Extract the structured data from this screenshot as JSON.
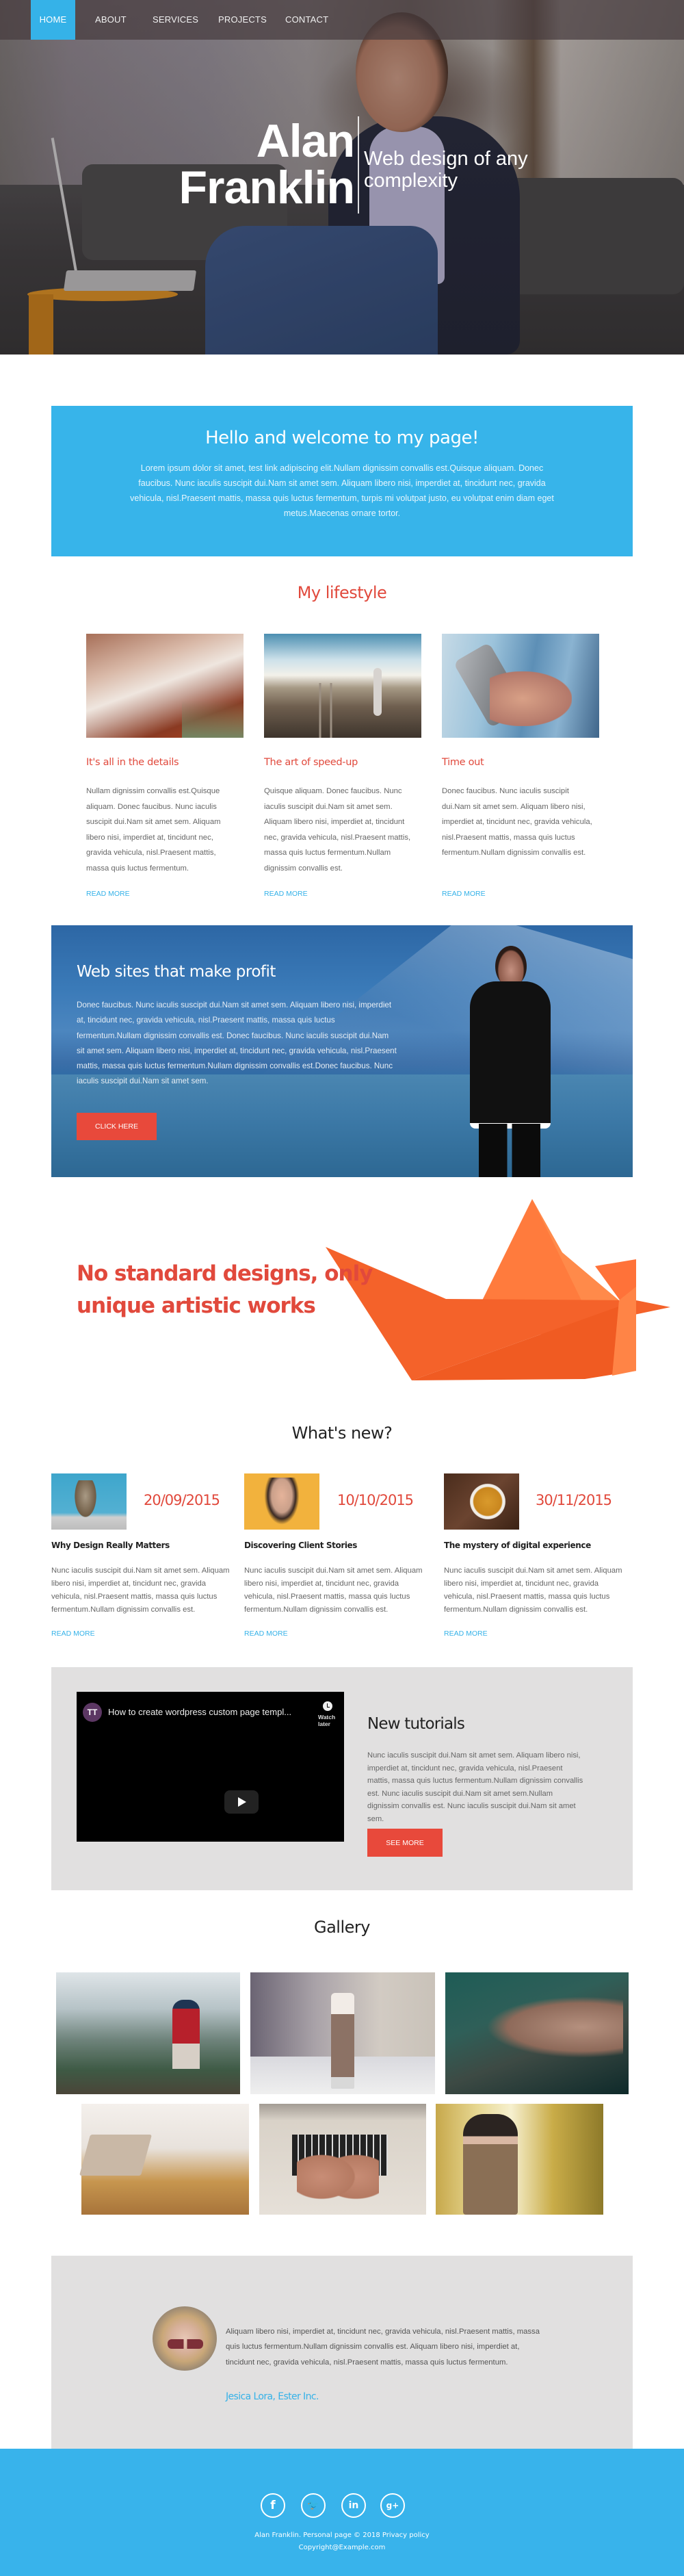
{
  "nav": {
    "items": [
      {
        "label": "Home",
        "active": true
      },
      {
        "label": "About",
        "active": false
      },
      {
        "label": "Services",
        "active": false
      },
      {
        "label": "Projects",
        "active": false
      },
      {
        "label": "Contact",
        "active": false
      }
    ]
  },
  "hero": {
    "name_line1": "Alan",
    "name_line2": "Franklin",
    "tagline": "Web design of any complexity"
  },
  "welcome": {
    "title": "Hello and welcome to my page!",
    "text": "Lorem ipsum dolor sit amet, test link adipiscing elit.Nullam dignissim convallis est.Quisque aliquam. Donec faucibus. Nunc iaculis suscipit dui.Nam sit amet sem. Aliquam libero nisi, imperdiet at, tincidunt nec, gravida vehicula, nisl.Praesent mattis, massa quis luctus fermentum, turpis mi volutpat justo, eu volutpat enim diam eget metus.Maecenas ornare tortor."
  },
  "lifestyle": {
    "title": "My lifestyle",
    "items": [
      {
        "image": "autumn-forest-path-photo",
        "title": "It's all in the details",
        "text": "Nullam dignissim convallis est.Quisque aliquam. Donec faucibus. Nunc iaculis suscipit dui.Nam sit amet sem. Aliquam libero nisi, imperdiet at, tincidunt nec, gravida vehicula, nisl.Praesent mattis, massa quis luctus fermentum.",
        "link": "Read more"
      },
      {
        "image": "railway-walker-photo",
        "title": "The art of speed-up",
        "text": "Quisque aliquam. Donec faucibus. Nunc iaculis suscipit dui.Nam sit amet sem. Aliquam libero nisi, imperdiet at, tincidunt nec, gravida vehicula, nisl.Praesent mattis, massa quis luctus fermentum.Nullam dignissim convallis est.",
        "link": "Read more"
      },
      {
        "image": "hand-holding-phone-photo",
        "title": "Time out",
        "text": "Donec faucibus. Nunc iaculis suscipit dui.Nam sit amet sem. Aliquam libero nisi, imperdiet at, tincidunt nec, gravida vehicula, nisl.Praesent mattis, massa quis luctus fermentum.Nullam dignissim convallis est.",
        "link": "Read more"
      }
    ]
  },
  "profit": {
    "title": "Web sites that make profit",
    "text": "Donec faucibus. Nunc iaculis suscipit dui.Nam sit amet sem. Aliquam libero nisi, imperdiet at, tincidunt nec, gravida vehicula, nisl.Praesent mattis, massa quis luctus fermentum.Nullam dignissim convallis est. Donec faucibus. Nunc iaculis suscipit dui.Nam sit amet sem. Aliquam libero nisi, imperdiet at, tincidunt nec, gravida vehicula, nisl.Praesent mattis, massa quis luctus fermentum.Nullam dignissim convallis est.Donec faucibus. Nunc iaculis suscipit dui.Nam sit amet sem.",
    "button": "Click here"
  },
  "artistic": {
    "text": "No standard designs, only unique artistic works"
  },
  "news": {
    "title": "What's new?",
    "items": [
      {
        "image": "sparrow-photo",
        "date": "20/09/2015",
        "title": "Why Design Really Matters",
        "text": "Nunc iaculis suscipit dui.Nam sit amet sem. Aliquam libero nisi, imperdiet at, tincidunt nec, gravida vehicula, nisl.Praesent mattis, massa quis luctus fermentum.Nullam dignissim convallis est.",
        "link": "Read more"
      },
      {
        "image": "surprised-girl-photo",
        "date": "10/10/2015",
        "title": "Discovering Client Stories",
        "text": "Nunc iaculis suscipit dui.Nam sit amet sem. Aliquam libero nisi, imperdiet at, tincidunt nec, gravida vehicula, nisl.Praesent mattis, massa quis luctus fermentum.Nullam dignissim convallis est.",
        "link": "Read more"
      },
      {
        "image": "coffee-cup-photo",
        "date": "30/11/2015",
        "title": "The mystery of digital experience",
        "text": "Nunc iaculis suscipit dui.Nam sit amet sem. Aliquam libero nisi, imperdiet at, tincidunt nec, gravida vehicula, nisl.Praesent mattis, massa quis luctus fermentum.Nullam dignissim convallis est.",
        "link": "Read more"
      }
    ]
  },
  "tutorials": {
    "video": {
      "channel_initials": "TT",
      "title": "How to create wordpress custom page templ...",
      "watch_later": "Watch later"
    },
    "title": "New tutorials",
    "text": "Nunc iaculis suscipit dui.Nam sit amet sem. Aliquam libero nisi, imperdiet at, tincidunt nec, gravida vehicula, nisl.Praesent mattis, massa quis luctus fermentum.Nullam dignissim convallis est. Nunc iaculis suscipit dui.Nam sit amet sem.Nullam dignissim convallis est. Nunc iaculis suscipit dui.Nam sit amet sem.",
    "button": "See more"
  },
  "gallery": {
    "title": "Gallery",
    "images": [
      "hiker-on-mountain-photo",
      "hot-chocolate-glass-photo",
      "wristwatch-photo",
      "laptops-cafe-photo",
      "typing-on-laptop-photo",
      "man-in-autumn-photo"
    ]
  },
  "testimonial": {
    "text": "Aliquam libero nisi, imperdiet at, tincidunt nec, gravida vehicula, nisl.Praesent mattis, massa quis luctus fermentum.Nullam dignissim convallis est. Aliquam libero nisi, imperdiet at, tincidunt nec, gravida vehicula, nisl.Praesent mattis, massa quis luctus fermentum.",
    "author": "Jesica Lora, Ester Inc."
  },
  "footer": {
    "social": [
      {
        "name": "facebook",
        "glyph": "f"
      },
      {
        "name": "twitter",
        "glyph": "🐦"
      },
      {
        "name": "linkedin",
        "glyph": "in"
      },
      {
        "name": "google-plus",
        "glyph": "g+"
      }
    ],
    "line1": "Alan Franklin. Personal page © 2018 Privacy policy",
    "line2": "Copyright@Example.com"
  },
  "colors": {
    "accent_blue": "#37b4ea",
    "accent_red": "#e1493c",
    "panel_gray": "#e1e0e0"
  }
}
